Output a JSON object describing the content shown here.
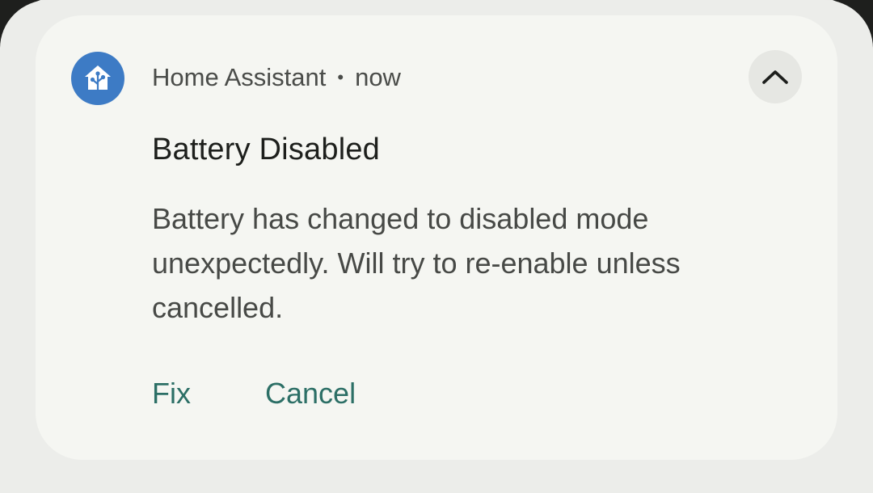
{
  "notification": {
    "app_name": "Home Assistant",
    "separator": "•",
    "time": "now",
    "app_icon": "home-assistant-icon",
    "expand_icon": "chevron-up-icon",
    "title": "Battery Disabled",
    "body": "Battery has changed to disabled mode unexpectedly. Will try to re-enable unless cancelled.",
    "actions": [
      {
        "label": "Fix"
      },
      {
        "label": "Cancel"
      }
    ]
  },
  "colors": {
    "screen_background": "#ecedea",
    "card_background": "#f5f6f2",
    "app_icon_background": "#3d7bc5",
    "action_text": "#2c6f66",
    "title_text": "#1d1f1c",
    "body_text": "#474946"
  }
}
